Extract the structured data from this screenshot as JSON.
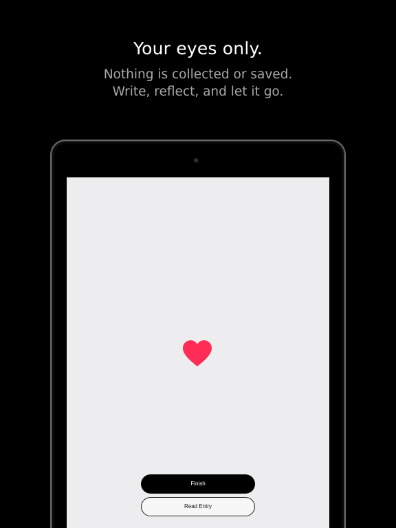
{
  "promo": {
    "headline": "Your eyes only.",
    "subline_1": "Nothing is collected or saved.",
    "subline_2": "Write, reflect, and let it go."
  },
  "device": {
    "screen": {
      "heart_icon": "heart-icon",
      "heart_color": "#ff2d55",
      "background_color": "#edecee",
      "finish_label": "Finish",
      "read_entry_label": "Read Entry"
    }
  }
}
